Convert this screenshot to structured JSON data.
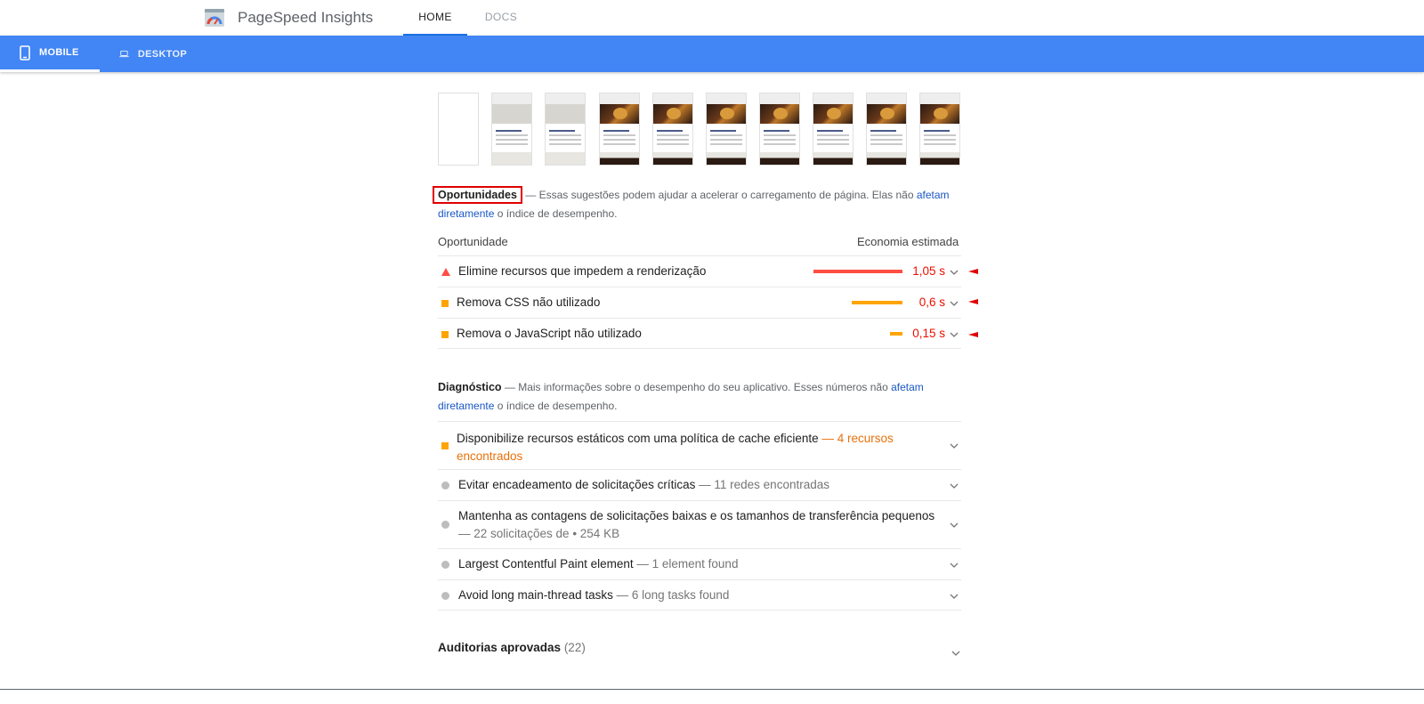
{
  "header": {
    "app_title": "PageSpeed Insights",
    "nav_tabs": [
      {
        "label": "HOME",
        "active": true
      },
      {
        "label": "DOCS",
        "active": false
      }
    ]
  },
  "device_tabs": [
    {
      "label": "MOBILE",
      "icon": "phone-icon",
      "active": true
    },
    {
      "label": "DESKTOP",
      "icon": "laptop-icon",
      "active": false
    }
  ],
  "colors": {
    "accent_blue": "#4285f4",
    "fail_red": "#ff4e42",
    "average_orange": "#ffa400",
    "value_red": "#eb0f00",
    "link_blue": "#1a57c6",
    "highlight_red": "#e00000"
  },
  "opportunities": {
    "heading": "Oportunidades",
    "desc_before": " — Essas sugestões podem ajudar a acelerar o carregamento de página. Elas não ",
    "link_text": "afetam diretamente",
    "desc_after": " o índice de desempenho.",
    "column_left": "Oportunidade",
    "column_right": "Economia estimada",
    "items": [
      {
        "title": "Elimine recursos que impedem a renderização",
        "value": "1,05 s",
        "savings_fraction": 1.0,
        "severity": "fail",
        "marker": "triangle"
      },
      {
        "title": "Remova CSS não utilizado",
        "value": "0,6 s",
        "savings_fraction": 0.57,
        "severity": "average",
        "marker": "square"
      },
      {
        "title": "Remova o JavaScript não utilizado",
        "value": "0,15 s",
        "savings_fraction": 0.14,
        "severity": "average",
        "marker": "square"
      }
    ]
  },
  "diagnostics": {
    "heading": "Diagnóstico",
    "desc_before": " — Mais informações sobre o desempenho do seu aplicativo. Esses números não ",
    "link_text": "afetam diretamente",
    "desc_after": " o índice de desempenho.",
    "items": [
      {
        "title": "Disponibilize recursos estáticos com uma política de cache eficiente",
        "detail": " — 4 recursos encontrados",
        "marker": "square"
      },
      {
        "title": "Evitar encadeamento de solicitações críticas",
        "detail": " — 11 redes encontradas",
        "marker": "dot"
      },
      {
        "title": "Mantenha as contagens de solicitações baixas e os tamanhos de transferência pequenos",
        "detail": " — 22 solicitações de • 254 KB",
        "marker": "dot"
      },
      {
        "title": "Largest Contentful Paint element",
        "detail": " — 1 element found",
        "marker": "dot"
      },
      {
        "title": "Avoid long main-thread tasks",
        "detail": " — 6 long tasks found",
        "marker": "dot"
      }
    ]
  },
  "passed_audits": {
    "label": "Auditorias aprovadas",
    "count": "(22)"
  },
  "filmstrip": {
    "frames": [
      "blank",
      "grey",
      "grey",
      "image",
      "image",
      "image",
      "image",
      "image",
      "image",
      "image"
    ]
  }
}
